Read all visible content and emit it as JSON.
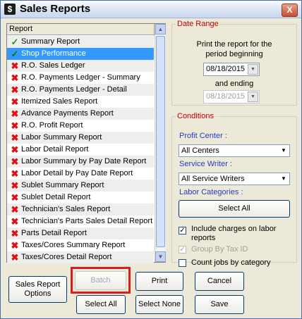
{
  "window": {
    "title": "Sales Reports",
    "close_glyph": "X"
  },
  "report_list": {
    "header": "Report",
    "items": [
      {
        "label": "Summary Report",
        "status": "check",
        "selected": false
      },
      {
        "label": "Shop Performance",
        "status": "check",
        "selected": true
      },
      {
        "label": "R.O. Sales Ledger",
        "status": "x",
        "selected": false
      },
      {
        "label": "R.O. Payments Ledger - Summary",
        "status": "x",
        "selected": false
      },
      {
        "label": "R.O. Payments Ledger - Detail",
        "status": "x",
        "selected": false
      },
      {
        "label": "Itemized Sales Report",
        "status": "x",
        "selected": false
      },
      {
        "label": "Advance Payments Report",
        "status": "x",
        "selected": false
      },
      {
        "label": "R.O. Profit Report",
        "status": "x",
        "selected": false
      },
      {
        "label": "Labor Summary Report",
        "status": "x",
        "selected": false
      },
      {
        "label": "Labor Detail Report",
        "status": "x",
        "selected": false
      },
      {
        "label": "Labor Summary by Pay Date Report",
        "status": "x",
        "selected": false
      },
      {
        "label": "Labor Detail by Pay Date Report",
        "status": "x",
        "selected": false
      },
      {
        "label": "Sublet Summary Report",
        "status": "x",
        "selected": false
      },
      {
        "label": "Sublet Detail Report",
        "status": "x",
        "selected": false
      },
      {
        "label": "Technician's Sales Report",
        "status": "x",
        "selected": false
      },
      {
        "label": "Technician's Parts Sales Detail Report",
        "status": "x",
        "selected": false
      },
      {
        "label": "Parts Detail Report",
        "status": "x",
        "selected": false
      },
      {
        "label": "Taxes/Cores Summary Report",
        "status": "x",
        "selected": false
      },
      {
        "label": "Taxes/Cores Detail Report",
        "status": "x",
        "selected": false
      }
    ]
  },
  "date_range": {
    "legend": "Date Range",
    "intro_line1": "Print the report for the",
    "intro_line2": "period beginning",
    "start_date": "08/18/2015",
    "and_ending": "and ending",
    "end_date": "08/18/2015"
  },
  "conditions": {
    "legend": "Conditions",
    "profit_center_label": "Profit Center :",
    "profit_center_value": "All Centers",
    "service_writer_label": "Service Writer :",
    "service_writer_value": "All Service Writers",
    "labor_categories_label": "Labor Categories :",
    "select_all_button": "Select All",
    "include_charges_line1": "Include charges on labor",
    "include_charges_line2": "reports",
    "include_charges_checked": true,
    "group_by_tax": "Group By Tax ID",
    "group_by_tax_checked": true,
    "count_jobs": "Count jobs by category",
    "count_jobs_checked": false
  },
  "buttons": {
    "sales_report_options_line1": "Sales Report",
    "sales_report_options_line2": "Options",
    "batch": "Batch",
    "print": "Print",
    "cancel": "Cancel",
    "select_all": "Select All",
    "select_none": "Select None",
    "save": "Save"
  },
  "colors": {
    "accent_red": "#c00000",
    "label_blue": "#1f3fbf",
    "selection": "#3399ff",
    "x_mark": "#e01010",
    "check_mark": "#1a9a1a"
  },
  "icons": {
    "app": "sales-app-icon",
    "close": "close-icon",
    "check": "check-icon",
    "x": "x-icon",
    "dropdown": "chevron-down-icon"
  }
}
